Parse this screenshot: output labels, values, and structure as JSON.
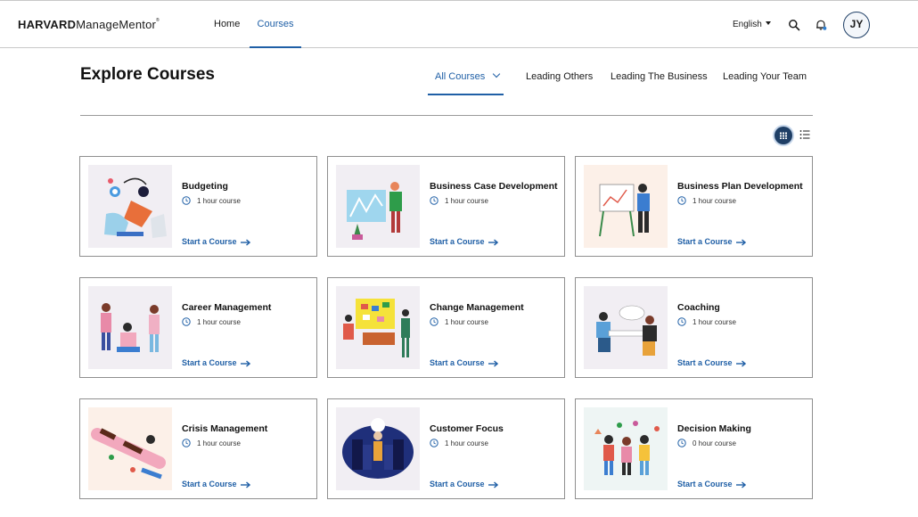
{
  "header": {
    "logo_bold": "HARVARD",
    "logo_regular": "ManageMentor",
    "logo_mark": "®",
    "nav": {
      "home": "Home",
      "courses": "Courses"
    },
    "language": "English",
    "avatar_initials": "JY"
  },
  "page": {
    "title": "Explore Courses",
    "filters": {
      "all": "All Courses",
      "leading_others": "Leading Others",
      "leading_business": "Leading The Business",
      "leading_team": "Leading Your Team"
    },
    "active_view": "grid"
  },
  "courses": [
    {
      "title": "Budgeting",
      "duration": "1 hour course",
      "cta": "Start a Course",
      "thumb_bg": "#f1eef3"
    },
    {
      "title": "Business Case Development",
      "duration": "1 hour course",
      "cta": "Start a Course",
      "thumb_bg": "#f1eef3"
    },
    {
      "title": "Business Plan Development",
      "duration": "1 hour course",
      "cta": "Start a Course",
      "thumb_bg": "#fcf0e8"
    },
    {
      "title": "Career Management",
      "duration": "1 hour course",
      "cta": "Start a Course",
      "thumb_bg": "#f1eef3"
    },
    {
      "title": "Change Management",
      "duration": "1 hour course",
      "cta": "Start a Course",
      "thumb_bg": "#f1eef3"
    },
    {
      "title": "Coaching",
      "duration": "1 hour course",
      "cta": "Start a Course",
      "thumb_bg": "#f1eef3"
    },
    {
      "title": "Crisis Management",
      "duration": "1 hour course",
      "cta": "Start a Course",
      "thumb_bg": "#fcf0e8"
    },
    {
      "title": "Customer Focus",
      "duration": "1 hour course",
      "cta": "Start a Course",
      "thumb_bg": "#f1eef3"
    },
    {
      "title": "Decision Making",
      "duration": "0 hour course",
      "cta": "Start a Course",
      "thumb_bg": "#eef5f4"
    }
  ],
  "colors": {
    "accent": "#1f5fa6",
    "navy": "#1f3f66",
    "card_border": "#8f8f8f"
  }
}
